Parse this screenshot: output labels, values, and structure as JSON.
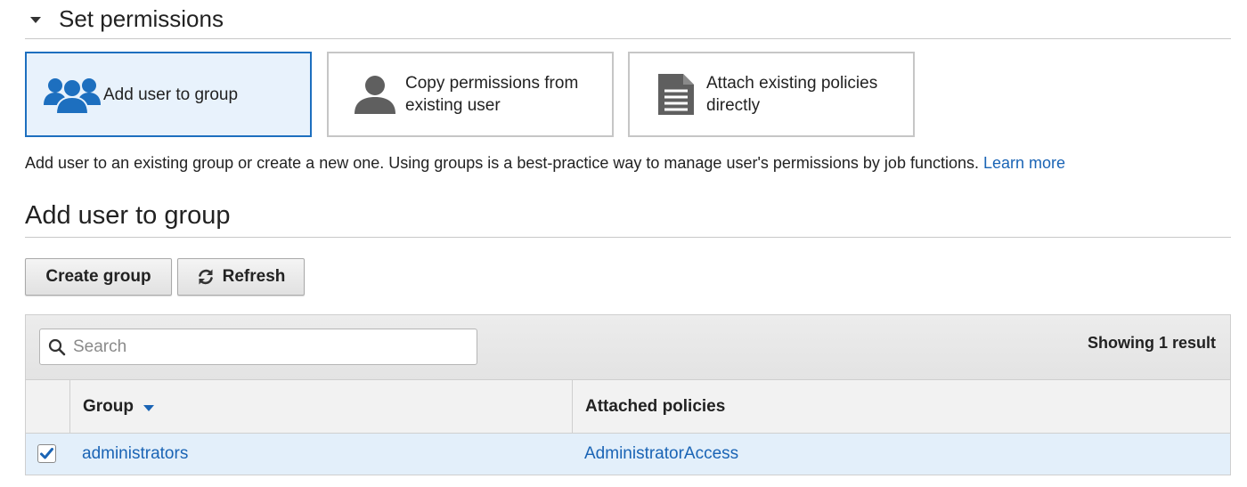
{
  "section": {
    "title": "Set permissions"
  },
  "options": [
    {
      "label_line1": "Add user to group",
      "label_line2": "",
      "icon": "users-group-icon",
      "selected": true
    },
    {
      "label_line1": "Copy permissions from",
      "label_line2": "existing user",
      "icon": "user-icon",
      "selected": false
    },
    {
      "label_line1": "Attach existing policies",
      "label_line2": "directly",
      "icon": "document-icon",
      "selected": false
    }
  ],
  "description": {
    "text": "Add user to an existing group or create a new one. Using groups is a best-practice way to manage user's permissions by job functions.",
    "link": "Learn more"
  },
  "group_section": {
    "title": "Add user to group"
  },
  "toolbar": {
    "create_label": "Create group",
    "refresh_label": "Refresh"
  },
  "table": {
    "search_placeholder": "Search",
    "result_count": "Showing 1 result",
    "columns": {
      "group": "Group",
      "policies": "Attached policies"
    },
    "rows": [
      {
        "group": "administrators",
        "policies": "AdministratorAccess",
        "checked": true
      }
    ]
  },
  "colors": {
    "accent": "#1a64b5",
    "selected_bg": "#e8f2fc",
    "row_selected_bg": "#e3effa"
  }
}
